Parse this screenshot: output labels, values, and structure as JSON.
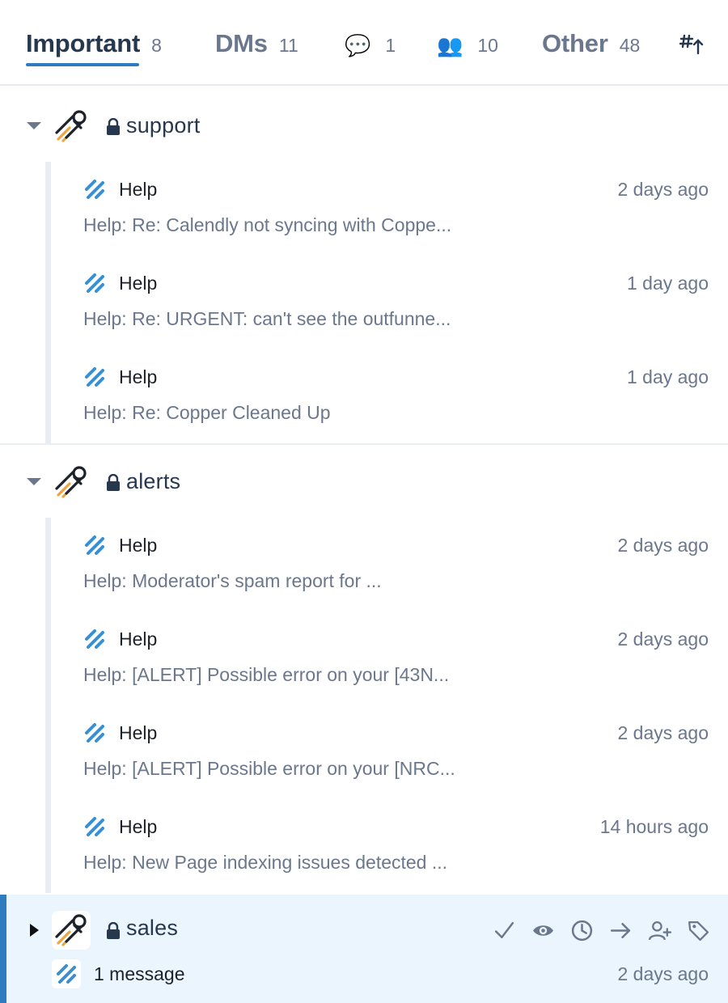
{
  "tabs": [
    {
      "label": "Important",
      "count": "8"
    },
    {
      "label": "DMs",
      "count": "11"
    },
    {
      "icon": "speech-bubble-icon",
      "glyph": "💬",
      "count": "1"
    },
    {
      "icon": "people-icon",
      "glyph": "👥",
      "count": "10"
    },
    {
      "label": "Other",
      "count": "48"
    }
  ],
  "sort_icon": "hashtag-sort-up-icon",
  "groups": [
    {
      "name": "support",
      "threads": [
        {
          "sender": "Help",
          "time": "2 days ago",
          "preview": "Help: Re: Calendly not syncing with Coppe..."
        },
        {
          "sender": "Help",
          "time": "1 day ago",
          "preview": "Help: Re: URGENT: can't see the outfunne..."
        },
        {
          "sender": "Help",
          "time": "1 day ago",
          "preview": "Help: Re: Copper Cleaned Up"
        }
      ]
    },
    {
      "name": "alerts",
      "threads": [
        {
          "sender": "Help",
          "time": "2 days ago",
          "preview": "Help: Moderator's spam report for ..."
        },
        {
          "sender": "Help",
          "time": "2 days ago",
          "preview": "Help: [ALERT] Possible error on your [43N..."
        },
        {
          "sender": "Help",
          "time": "2 days ago",
          "preview": "Help: [ALERT] Possible error on your [NRC..."
        },
        {
          "sender": "Help",
          "time": "14 hours ago",
          "preview": "Help: New Page indexing issues detected ..."
        }
      ]
    }
  ],
  "collapsed_group": {
    "name": "sales",
    "message_count": "1 message",
    "time": "2 days ago",
    "actions": [
      "check-icon",
      "eye-icon",
      "clock-icon",
      "arrow-right-icon",
      "add-user-icon",
      "tag-icon"
    ]
  },
  "colors": {
    "accent": "#2f7bbf",
    "selected_bg": "#eaf5fd",
    "muted_text": "#6b778c"
  }
}
